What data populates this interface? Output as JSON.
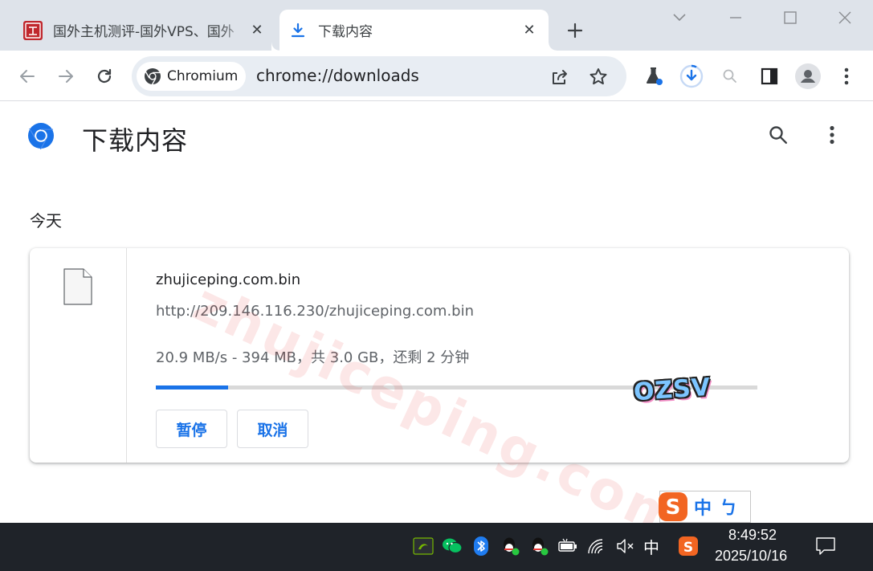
{
  "tabs": [
    {
      "title": "国外主机测评-国外VPS、国外",
      "active": false,
      "favicon": "site-logo-icon"
    },
    {
      "title": "下载内容",
      "active": true,
      "favicon": "download-icon"
    }
  ],
  "toolbar": {
    "site_chip_label": "Chromium",
    "url": "chrome://downloads"
  },
  "page": {
    "title": "下载内容",
    "section_date": "今天"
  },
  "download": {
    "file_name": "zhujiceping.com.bin",
    "url": "http://209.146.116.230/zhujiceping.com.bin",
    "status": "20.9 MB/s - 394 MB，共 3.0 GB，还剩 2 分钟",
    "progress": 0.12,
    "pause_label": "暂停",
    "cancel_label": "取消"
  },
  "watermark": {
    "text": "zhujiceping.com",
    "badge": "OZSV"
  },
  "ime": {
    "mode_label": "中",
    "punct_label": "ㄅ"
  },
  "taskbar": {
    "lang": "中",
    "time": "8:49:52",
    "date": "2025/10/16"
  },
  "colors": {
    "accent": "#1a73e8",
    "tabstrip": "#dee3ea",
    "omnibox": "#e8edf3",
    "taskbar": "#1f2329"
  }
}
